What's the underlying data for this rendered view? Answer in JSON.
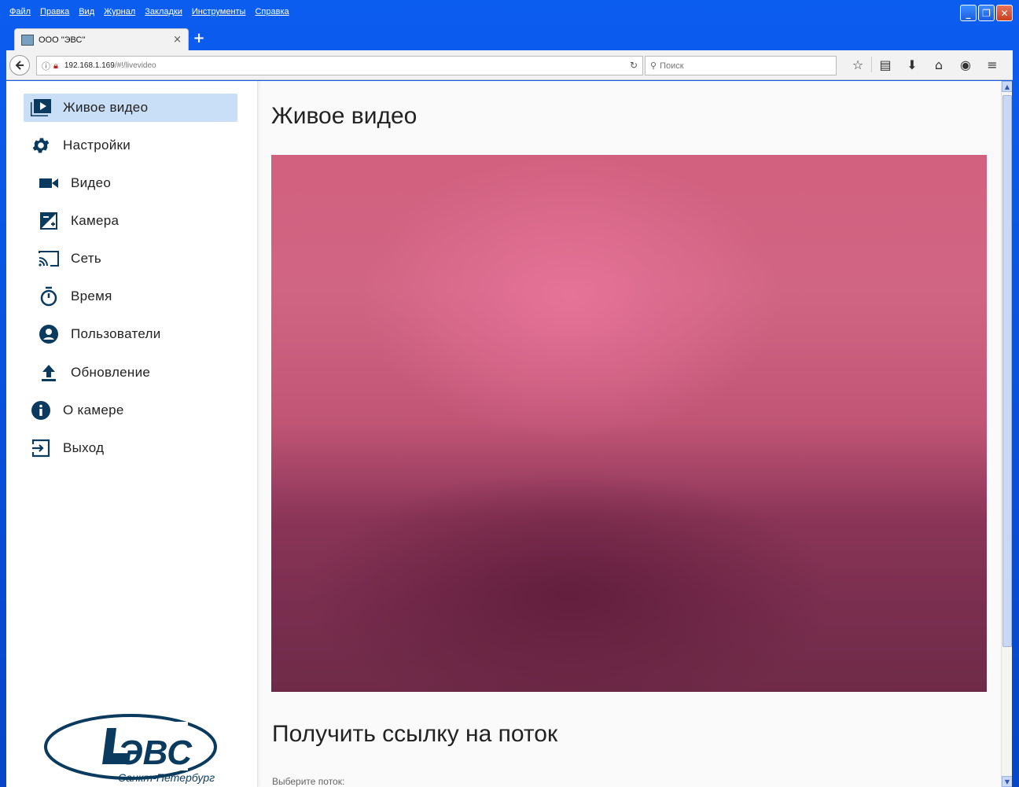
{
  "menubar": {
    "items": [
      "Файл",
      "Правка",
      "Вид",
      "Журнал",
      "Закладки",
      "Инструменты",
      "Справка"
    ]
  },
  "window_controls": {
    "minimize": "_",
    "maximize": "❐",
    "close": "✕"
  },
  "tab": {
    "title": "ООО \"ЭВС\"",
    "close": "×",
    "new_tab": "+"
  },
  "navbar": {
    "url_host": "192.168.1.169",
    "url_path": "/#!/livevideo",
    "search_placeholder": "Поиск"
  },
  "sidebar": {
    "items": [
      {
        "label": "Живое видео",
        "icon": "live-video-icon",
        "active": true
      },
      {
        "label": "Настройки",
        "icon": "gear-icon"
      },
      {
        "label": "Видео",
        "icon": "videocam-icon"
      },
      {
        "label": "Камера",
        "icon": "exposure-icon"
      },
      {
        "label": "Сеть",
        "icon": "cast-icon"
      },
      {
        "label": "Время",
        "icon": "timer-icon"
      },
      {
        "label": "Пользователи",
        "icon": "account-icon"
      },
      {
        "label": "Обновление",
        "icon": "upload-icon"
      },
      {
        "label": "О камере",
        "icon": "info-icon"
      },
      {
        "label": "Выход",
        "icon": "exit-icon"
      }
    ],
    "logo": {
      "brand": "ЭВС",
      "city": "Санкт-Петербург"
    }
  },
  "main": {
    "title": "Живое видео",
    "stream_section_title": "Получить ссылку на поток",
    "stream_select_label": "Выберите поток:"
  },
  "colors": {
    "accent": "#0a3a5e",
    "active_bg": "#c9dff7",
    "video": "#c05576"
  }
}
